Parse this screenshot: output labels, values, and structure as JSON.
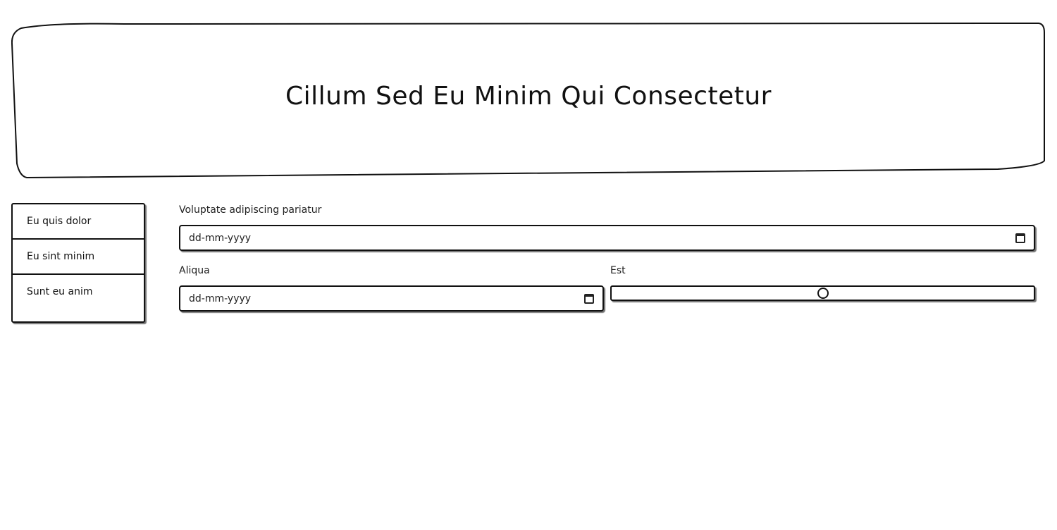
{
  "header": {
    "title": "Cillum Sed Eu Minim Qui Consectetur"
  },
  "sidebar": {
    "items": [
      {
        "label": "Eu quis dolor"
      },
      {
        "label": "Eu sint minim"
      },
      {
        "label": "Sunt eu anim"
      }
    ]
  },
  "form": {
    "field1": {
      "label": "Voluptate adipiscing pariatur",
      "placeholder": "dd-mm-yyyy"
    },
    "field2": {
      "label": "Aliqua",
      "placeholder": "dd-mm-yyyy"
    },
    "field3": {
      "label": "Est",
      "value_fraction": 0.5
    }
  },
  "icons": {
    "date_icon": "calendar-icon"
  }
}
